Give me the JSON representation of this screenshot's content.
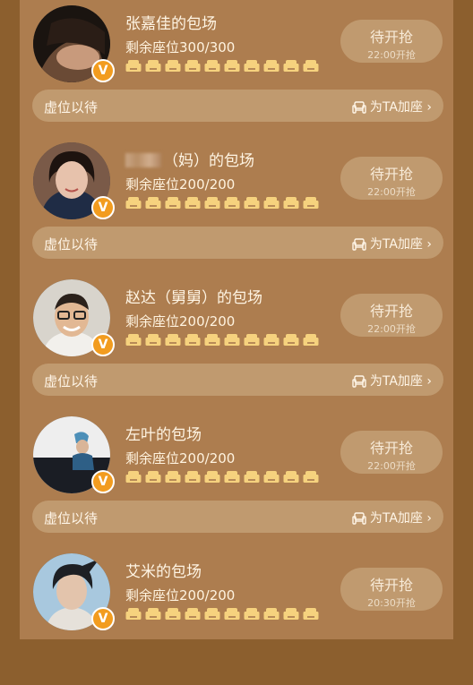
{
  "colors": {
    "accent": "#f29c1f",
    "seat_icon": "#f6d27e",
    "panel": "#ad7d4f",
    "pill": "#c09a6f"
  },
  "common": {
    "seat_prefix": "剩余座位",
    "wait_label": "虚位以待",
    "add_seat_label": "为TA加座",
    "add_seat_icon": "sofa-outline-icon",
    "chevron": "›",
    "badge_text": "V"
  },
  "cards": [
    {
      "title": "张嘉佳的包场",
      "name_blurred": false,
      "seats": "300/300",
      "button": "待开抢",
      "time": "22:00开抢"
    },
    {
      "title": "（妈）的包场",
      "name_blurred": true,
      "seats": "200/200",
      "button": "待开抢",
      "time": "22:00开抢"
    },
    {
      "title": "赵达（舅舅）的包场",
      "name_blurred": false,
      "seats": "200/200",
      "button": "待开抢",
      "time": "22:00开抢"
    },
    {
      "title": "左叶的包场",
      "name_blurred": false,
      "seats": "200/200",
      "button": "待开抢",
      "time": "22:00开抢"
    },
    {
      "title": "艾米的包场",
      "name_blurred": false,
      "seats": "200/200",
      "button": "待开抢",
      "time": "20:30开抢"
    }
  ]
}
